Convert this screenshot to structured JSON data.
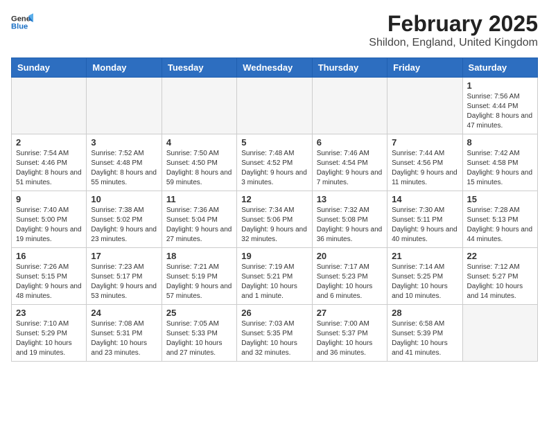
{
  "logo": {
    "general": "General",
    "blue": "Blue"
  },
  "title": "February 2025",
  "subtitle": "Shildon, England, United Kingdom",
  "weekdays": [
    "Sunday",
    "Monday",
    "Tuesday",
    "Wednesday",
    "Thursday",
    "Friday",
    "Saturday"
  ],
  "weeks": [
    [
      {
        "day": "",
        "info": ""
      },
      {
        "day": "",
        "info": ""
      },
      {
        "day": "",
        "info": ""
      },
      {
        "day": "",
        "info": ""
      },
      {
        "day": "",
        "info": ""
      },
      {
        "day": "",
        "info": ""
      },
      {
        "day": "1",
        "info": "Sunrise: 7:56 AM\nSunset: 4:44 PM\nDaylight: 8 hours and 47 minutes."
      }
    ],
    [
      {
        "day": "2",
        "info": "Sunrise: 7:54 AM\nSunset: 4:46 PM\nDaylight: 8 hours and 51 minutes."
      },
      {
        "day": "3",
        "info": "Sunrise: 7:52 AM\nSunset: 4:48 PM\nDaylight: 8 hours and 55 minutes."
      },
      {
        "day": "4",
        "info": "Sunrise: 7:50 AM\nSunset: 4:50 PM\nDaylight: 8 hours and 59 minutes."
      },
      {
        "day": "5",
        "info": "Sunrise: 7:48 AM\nSunset: 4:52 PM\nDaylight: 9 hours and 3 minutes."
      },
      {
        "day": "6",
        "info": "Sunrise: 7:46 AM\nSunset: 4:54 PM\nDaylight: 9 hours and 7 minutes."
      },
      {
        "day": "7",
        "info": "Sunrise: 7:44 AM\nSunset: 4:56 PM\nDaylight: 9 hours and 11 minutes."
      },
      {
        "day": "8",
        "info": "Sunrise: 7:42 AM\nSunset: 4:58 PM\nDaylight: 9 hours and 15 minutes."
      }
    ],
    [
      {
        "day": "9",
        "info": "Sunrise: 7:40 AM\nSunset: 5:00 PM\nDaylight: 9 hours and 19 minutes."
      },
      {
        "day": "10",
        "info": "Sunrise: 7:38 AM\nSunset: 5:02 PM\nDaylight: 9 hours and 23 minutes."
      },
      {
        "day": "11",
        "info": "Sunrise: 7:36 AM\nSunset: 5:04 PM\nDaylight: 9 hours and 27 minutes."
      },
      {
        "day": "12",
        "info": "Sunrise: 7:34 AM\nSunset: 5:06 PM\nDaylight: 9 hours and 32 minutes."
      },
      {
        "day": "13",
        "info": "Sunrise: 7:32 AM\nSunset: 5:08 PM\nDaylight: 9 hours and 36 minutes."
      },
      {
        "day": "14",
        "info": "Sunrise: 7:30 AM\nSunset: 5:11 PM\nDaylight: 9 hours and 40 minutes."
      },
      {
        "day": "15",
        "info": "Sunrise: 7:28 AM\nSunset: 5:13 PM\nDaylight: 9 hours and 44 minutes."
      }
    ],
    [
      {
        "day": "16",
        "info": "Sunrise: 7:26 AM\nSunset: 5:15 PM\nDaylight: 9 hours and 48 minutes."
      },
      {
        "day": "17",
        "info": "Sunrise: 7:23 AM\nSunset: 5:17 PM\nDaylight: 9 hours and 53 minutes."
      },
      {
        "day": "18",
        "info": "Sunrise: 7:21 AM\nSunset: 5:19 PM\nDaylight: 9 hours and 57 minutes."
      },
      {
        "day": "19",
        "info": "Sunrise: 7:19 AM\nSunset: 5:21 PM\nDaylight: 10 hours and 1 minute."
      },
      {
        "day": "20",
        "info": "Sunrise: 7:17 AM\nSunset: 5:23 PM\nDaylight: 10 hours and 6 minutes."
      },
      {
        "day": "21",
        "info": "Sunrise: 7:14 AM\nSunset: 5:25 PM\nDaylight: 10 hours and 10 minutes."
      },
      {
        "day": "22",
        "info": "Sunrise: 7:12 AM\nSunset: 5:27 PM\nDaylight: 10 hours and 14 minutes."
      }
    ],
    [
      {
        "day": "23",
        "info": "Sunrise: 7:10 AM\nSunset: 5:29 PM\nDaylight: 10 hours and 19 minutes."
      },
      {
        "day": "24",
        "info": "Sunrise: 7:08 AM\nSunset: 5:31 PM\nDaylight: 10 hours and 23 minutes."
      },
      {
        "day": "25",
        "info": "Sunrise: 7:05 AM\nSunset: 5:33 PM\nDaylight: 10 hours and 27 minutes."
      },
      {
        "day": "26",
        "info": "Sunrise: 7:03 AM\nSunset: 5:35 PM\nDaylight: 10 hours and 32 minutes."
      },
      {
        "day": "27",
        "info": "Sunrise: 7:00 AM\nSunset: 5:37 PM\nDaylight: 10 hours and 36 minutes."
      },
      {
        "day": "28",
        "info": "Sunrise: 6:58 AM\nSunset: 5:39 PM\nDaylight: 10 hours and 41 minutes."
      },
      {
        "day": "",
        "info": ""
      }
    ]
  ]
}
